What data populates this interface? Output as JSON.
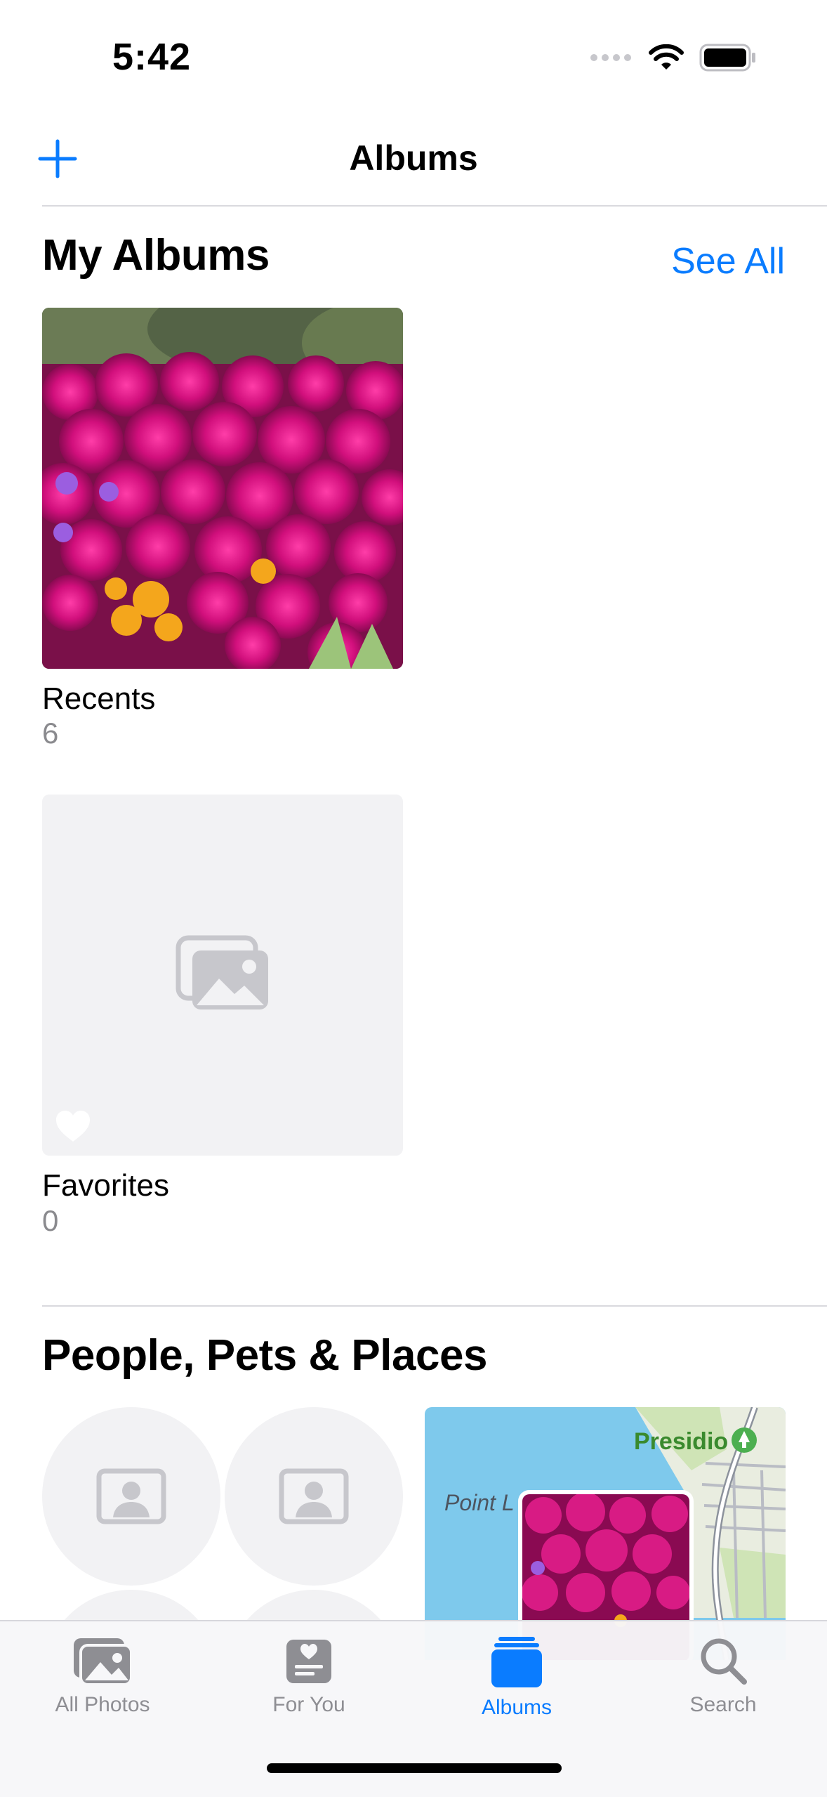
{
  "status": {
    "time": "5:42"
  },
  "nav": {
    "title": "Albums"
  },
  "my_albums": {
    "title": "My Albums",
    "see_all": "See All",
    "albums": [
      {
        "name": "Recents",
        "count": "6"
      },
      {
        "name": "Favorites",
        "count": "0"
      }
    ]
  },
  "people": {
    "title": "People, Pets & Places",
    "map_labels": {
      "presidio": "Presidio",
      "point": "Point L"
    }
  },
  "tabs": [
    {
      "label": "All Photos",
      "icon": "photo-stack-icon"
    },
    {
      "label": "For You",
      "icon": "for-you-icon"
    },
    {
      "label": "Albums",
      "icon": "albums-icon",
      "active": true
    },
    {
      "label": "Search",
      "icon": "search-icon"
    }
  ],
  "colors": {
    "accent": "#0a7cff",
    "secondary_text": "#8a8a8e"
  }
}
